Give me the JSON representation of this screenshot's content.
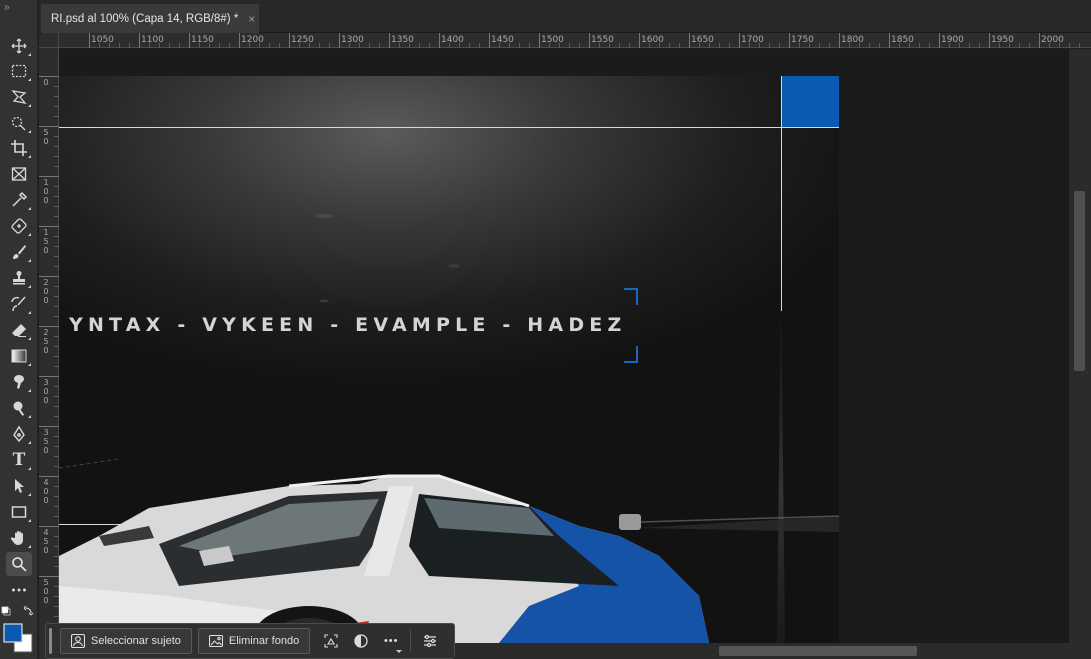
{
  "document_tab": {
    "title": "RI.psd al 100% (Capa 14, RGB/8#) *",
    "close_glyph": "×"
  },
  "tools_panel": {
    "collapse_glyph": "››",
    "tools": [
      {
        "id": "move",
        "icon": "move-tool-icon"
      },
      {
        "id": "marquee",
        "icon": "rectangular-marquee-icon"
      },
      {
        "id": "lasso",
        "icon": "polygonal-lasso-icon"
      },
      {
        "id": "quick-select",
        "icon": "quick-selection-icon"
      },
      {
        "id": "crop",
        "icon": "crop-icon"
      },
      {
        "id": "frame",
        "icon": "frame-icon"
      },
      {
        "id": "eyedropper",
        "icon": "eyedropper-icon"
      },
      {
        "id": "healing",
        "icon": "healing-brush-icon"
      },
      {
        "id": "brush",
        "icon": "brush-icon"
      },
      {
        "id": "stamp",
        "icon": "clone-stamp-icon"
      },
      {
        "id": "history-brush",
        "icon": "history-brush-icon"
      },
      {
        "id": "eraser",
        "icon": "eraser-icon"
      },
      {
        "id": "gradient",
        "icon": "gradient-icon"
      },
      {
        "id": "smudge",
        "icon": "smudge-icon"
      },
      {
        "id": "dodge",
        "icon": "dodge-icon"
      },
      {
        "id": "pen",
        "icon": "pen-icon"
      },
      {
        "id": "type",
        "icon": "type-icon",
        "label": "T"
      },
      {
        "id": "path-select",
        "icon": "path-selection-icon"
      },
      {
        "id": "shape",
        "icon": "rectangle-shape-icon"
      },
      {
        "id": "hand",
        "icon": "hand-icon"
      },
      {
        "id": "zoom",
        "icon": "zoom-icon",
        "active": true
      },
      {
        "id": "more",
        "icon": "more-tools-icon"
      }
    ],
    "foreground_color": "#0a5ab4",
    "background_color": "#ffffff"
  },
  "rulers": {
    "horizontal_labels": [
      "1050",
      "1100",
      "1150",
      "1200",
      "1250",
      "1300",
      "1350",
      "1400",
      "1450",
      "1500",
      "1550",
      "1600",
      "1650",
      "1700",
      "1750",
      "1800",
      "1850",
      "1900",
      "1950",
      "2000"
    ],
    "vertical_labels": [
      "0",
      "50",
      "100",
      "150",
      "200",
      "250",
      "300",
      "350",
      "400",
      "450",
      "500"
    ]
  },
  "canvas": {
    "artboard_text": "YNTAX - VYKEEN - EVAMPLE - HADEZ",
    "accent_color": "#0a5ab4"
  },
  "task_bar": {
    "select_subject_label": "Seleccionar sujeto",
    "remove_background_label": "Eliminar fondo",
    "more_glyph": "•••"
  }
}
